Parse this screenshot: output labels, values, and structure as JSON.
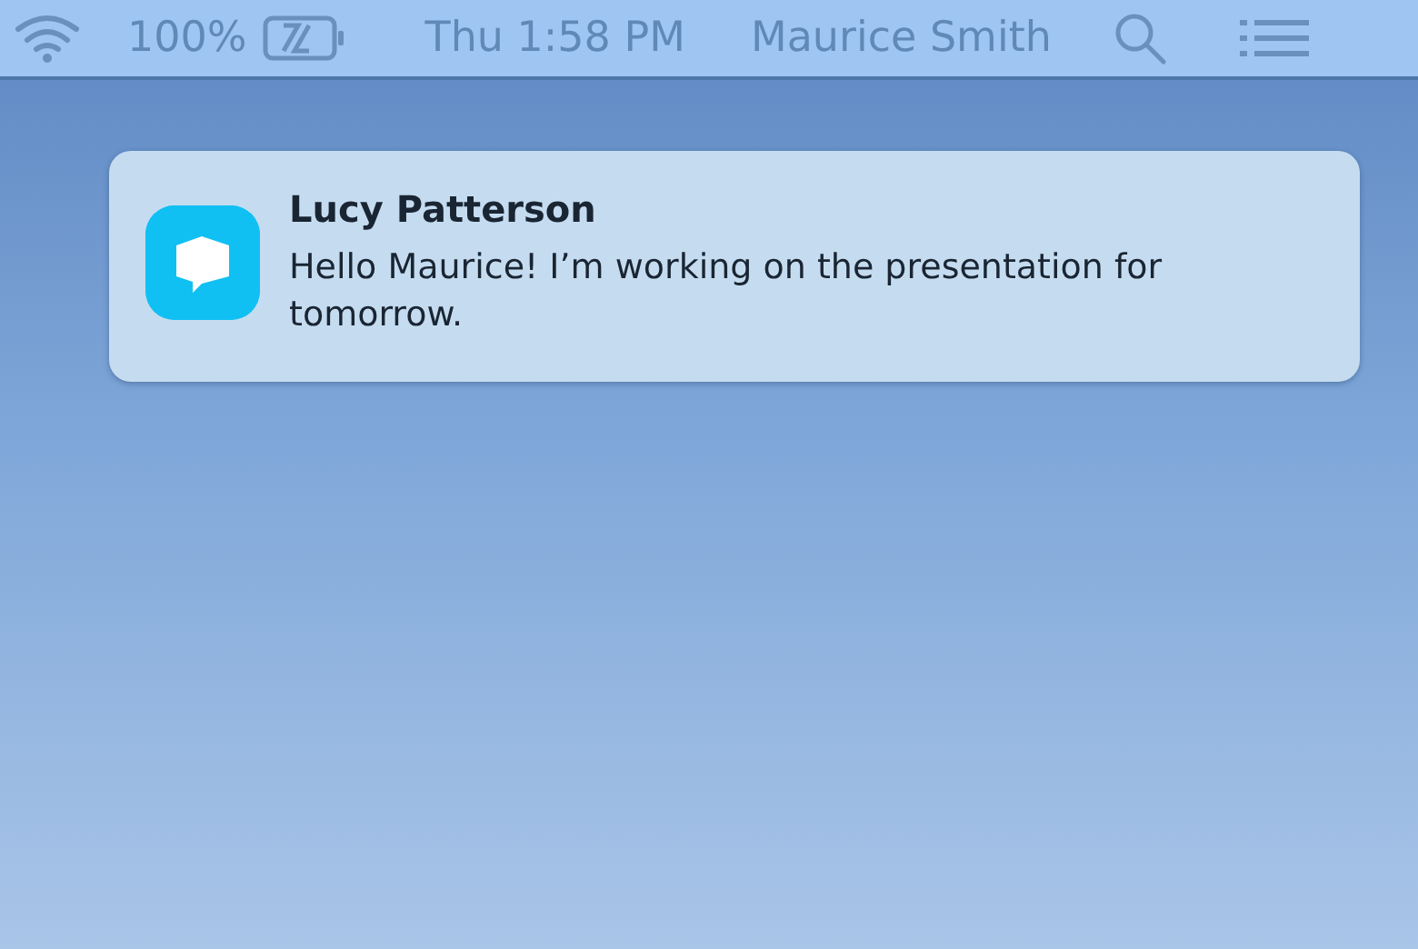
{
  "menu_bar": {
    "battery": "100%",
    "clock": "Thu 1:58 PM",
    "user": "Maurice Smith"
  },
  "notification": {
    "sender": "Lucy Patterson",
    "message": "Hello Maurice! I’m working on the presentation for tomorrow."
  }
}
